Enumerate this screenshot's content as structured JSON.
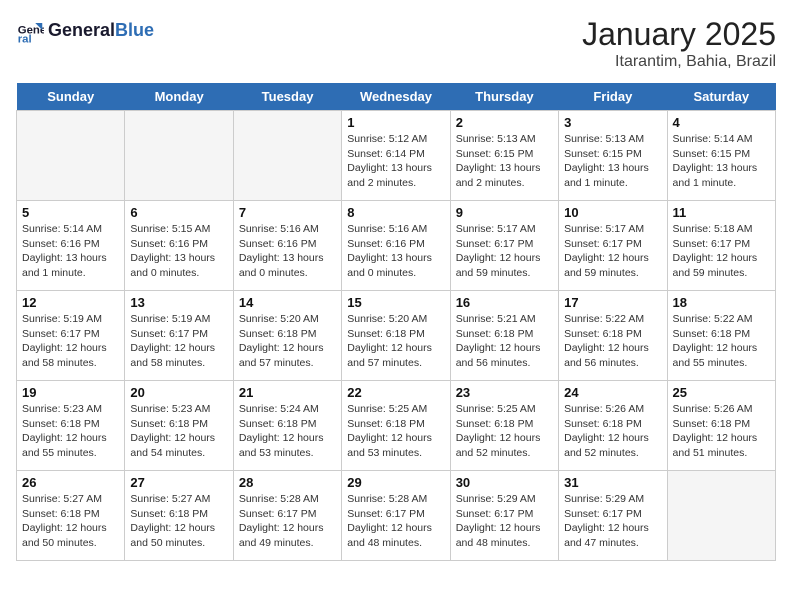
{
  "logo": {
    "general": "General",
    "blue": "Blue"
  },
  "title": "January 2025",
  "subtitle": "Itarantim, Bahia, Brazil",
  "headers": [
    "Sunday",
    "Monday",
    "Tuesday",
    "Wednesday",
    "Thursday",
    "Friday",
    "Saturday"
  ],
  "weeks": [
    [
      {
        "day": "",
        "sunrise": "",
        "sunset": "",
        "daylight": "",
        "empty": true
      },
      {
        "day": "",
        "sunrise": "",
        "sunset": "",
        "daylight": "",
        "empty": true
      },
      {
        "day": "",
        "sunrise": "",
        "sunset": "",
        "daylight": "",
        "empty": true
      },
      {
        "day": "1",
        "sunrise": "Sunrise: 5:12 AM",
        "sunset": "Sunset: 6:14 PM",
        "daylight": "Daylight: 13 hours and 2 minutes.",
        "empty": false
      },
      {
        "day": "2",
        "sunrise": "Sunrise: 5:13 AM",
        "sunset": "Sunset: 6:15 PM",
        "daylight": "Daylight: 13 hours and 2 minutes.",
        "empty": false
      },
      {
        "day": "3",
        "sunrise": "Sunrise: 5:13 AM",
        "sunset": "Sunset: 6:15 PM",
        "daylight": "Daylight: 13 hours and 1 minute.",
        "empty": false
      },
      {
        "day": "4",
        "sunrise": "Sunrise: 5:14 AM",
        "sunset": "Sunset: 6:15 PM",
        "daylight": "Daylight: 13 hours and 1 minute.",
        "empty": false
      }
    ],
    [
      {
        "day": "5",
        "sunrise": "Sunrise: 5:14 AM",
        "sunset": "Sunset: 6:16 PM",
        "daylight": "Daylight: 13 hours and 1 minute.",
        "empty": false
      },
      {
        "day": "6",
        "sunrise": "Sunrise: 5:15 AM",
        "sunset": "Sunset: 6:16 PM",
        "daylight": "Daylight: 13 hours and 0 minutes.",
        "empty": false
      },
      {
        "day": "7",
        "sunrise": "Sunrise: 5:16 AM",
        "sunset": "Sunset: 6:16 PM",
        "daylight": "Daylight: 13 hours and 0 minutes.",
        "empty": false
      },
      {
        "day": "8",
        "sunrise": "Sunrise: 5:16 AM",
        "sunset": "Sunset: 6:16 PM",
        "daylight": "Daylight: 13 hours and 0 minutes.",
        "empty": false
      },
      {
        "day": "9",
        "sunrise": "Sunrise: 5:17 AM",
        "sunset": "Sunset: 6:17 PM",
        "daylight": "Daylight: 12 hours and 59 minutes.",
        "empty": false
      },
      {
        "day": "10",
        "sunrise": "Sunrise: 5:17 AM",
        "sunset": "Sunset: 6:17 PM",
        "daylight": "Daylight: 12 hours and 59 minutes.",
        "empty": false
      },
      {
        "day": "11",
        "sunrise": "Sunrise: 5:18 AM",
        "sunset": "Sunset: 6:17 PM",
        "daylight": "Daylight: 12 hours and 59 minutes.",
        "empty": false
      }
    ],
    [
      {
        "day": "12",
        "sunrise": "Sunrise: 5:19 AM",
        "sunset": "Sunset: 6:17 PM",
        "daylight": "Daylight: 12 hours and 58 minutes.",
        "empty": false
      },
      {
        "day": "13",
        "sunrise": "Sunrise: 5:19 AM",
        "sunset": "Sunset: 6:17 PM",
        "daylight": "Daylight: 12 hours and 58 minutes.",
        "empty": false
      },
      {
        "day": "14",
        "sunrise": "Sunrise: 5:20 AM",
        "sunset": "Sunset: 6:18 PM",
        "daylight": "Daylight: 12 hours and 57 minutes.",
        "empty": false
      },
      {
        "day": "15",
        "sunrise": "Sunrise: 5:20 AM",
        "sunset": "Sunset: 6:18 PM",
        "daylight": "Daylight: 12 hours and 57 minutes.",
        "empty": false
      },
      {
        "day": "16",
        "sunrise": "Sunrise: 5:21 AM",
        "sunset": "Sunset: 6:18 PM",
        "daylight": "Daylight: 12 hours and 56 minutes.",
        "empty": false
      },
      {
        "day": "17",
        "sunrise": "Sunrise: 5:22 AM",
        "sunset": "Sunset: 6:18 PM",
        "daylight": "Daylight: 12 hours and 56 minutes.",
        "empty": false
      },
      {
        "day": "18",
        "sunrise": "Sunrise: 5:22 AM",
        "sunset": "Sunset: 6:18 PM",
        "daylight": "Daylight: 12 hours and 55 minutes.",
        "empty": false
      }
    ],
    [
      {
        "day": "19",
        "sunrise": "Sunrise: 5:23 AM",
        "sunset": "Sunset: 6:18 PM",
        "daylight": "Daylight: 12 hours and 55 minutes.",
        "empty": false
      },
      {
        "day": "20",
        "sunrise": "Sunrise: 5:23 AM",
        "sunset": "Sunset: 6:18 PM",
        "daylight": "Daylight: 12 hours and 54 minutes.",
        "empty": false
      },
      {
        "day": "21",
        "sunrise": "Sunrise: 5:24 AM",
        "sunset": "Sunset: 6:18 PM",
        "daylight": "Daylight: 12 hours and 53 minutes.",
        "empty": false
      },
      {
        "day": "22",
        "sunrise": "Sunrise: 5:25 AM",
        "sunset": "Sunset: 6:18 PM",
        "daylight": "Daylight: 12 hours and 53 minutes.",
        "empty": false
      },
      {
        "day": "23",
        "sunrise": "Sunrise: 5:25 AM",
        "sunset": "Sunset: 6:18 PM",
        "daylight": "Daylight: 12 hours and 52 minutes.",
        "empty": false
      },
      {
        "day": "24",
        "sunrise": "Sunrise: 5:26 AM",
        "sunset": "Sunset: 6:18 PM",
        "daylight": "Daylight: 12 hours and 52 minutes.",
        "empty": false
      },
      {
        "day": "25",
        "sunrise": "Sunrise: 5:26 AM",
        "sunset": "Sunset: 6:18 PM",
        "daylight": "Daylight: 12 hours and 51 minutes.",
        "empty": false
      }
    ],
    [
      {
        "day": "26",
        "sunrise": "Sunrise: 5:27 AM",
        "sunset": "Sunset: 6:18 PM",
        "daylight": "Daylight: 12 hours and 50 minutes.",
        "empty": false
      },
      {
        "day": "27",
        "sunrise": "Sunrise: 5:27 AM",
        "sunset": "Sunset: 6:18 PM",
        "daylight": "Daylight: 12 hours and 50 minutes.",
        "empty": false
      },
      {
        "day": "28",
        "sunrise": "Sunrise: 5:28 AM",
        "sunset": "Sunset: 6:17 PM",
        "daylight": "Daylight: 12 hours and 49 minutes.",
        "empty": false
      },
      {
        "day": "29",
        "sunrise": "Sunrise: 5:28 AM",
        "sunset": "Sunset: 6:17 PM",
        "daylight": "Daylight: 12 hours and 48 minutes.",
        "empty": false
      },
      {
        "day": "30",
        "sunrise": "Sunrise: 5:29 AM",
        "sunset": "Sunset: 6:17 PM",
        "daylight": "Daylight: 12 hours and 48 minutes.",
        "empty": false
      },
      {
        "day": "31",
        "sunrise": "Sunrise: 5:29 AM",
        "sunset": "Sunset: 6:17 PM",
        "daylight": "Daylight: 12 hours and 47 minutes.",
        "empty": false
      },
      {
        "day": "",
        "sunrise": "",
        "sunset": "",
        "daylight": "",
        "empty": true
      }
    ]
  ]
}
